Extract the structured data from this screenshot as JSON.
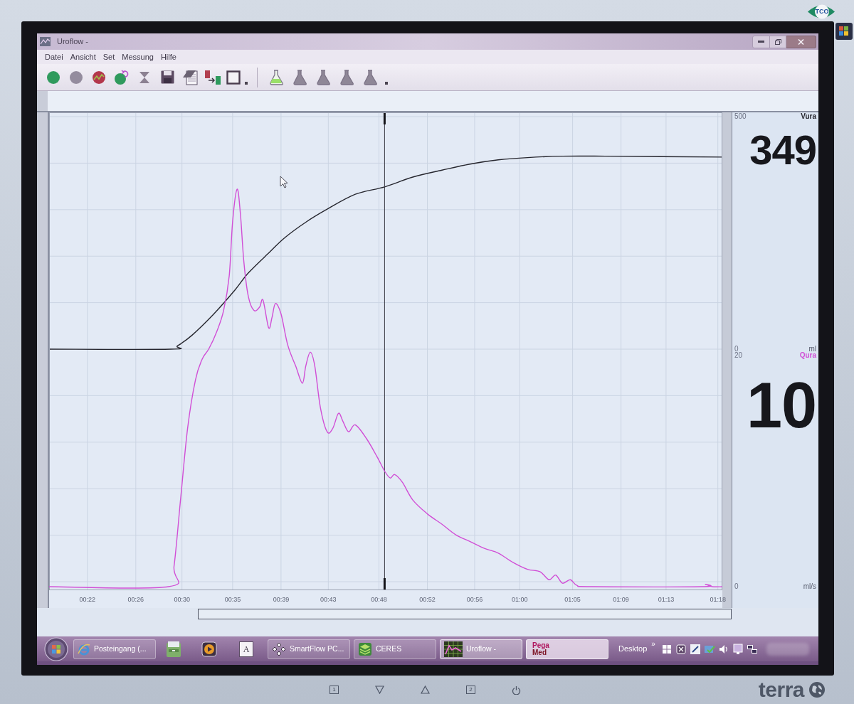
{
  "window": {
    "title": "Uroflow -"
  },
  "menu": [
    "Datei",
    "Ansicht",
    "Set",
    "Messung",
    "Hilfe"
  ],
  "toolbar": {
    "flasks": [
      {
        "selected": true
      },
      {
        "selected": false
      },
      {
        "selected": false
      },
      {
        "selected": false
      },
      {
        "selected": false
      }
    ]
  },
  "plot": {
    "volume_chart": {
      "chart_data": {
        "type": "line",
        "ylabel": "ml",
        "xlim": [
          18.6,
          78.4
        ],
        "ylim": [
          -518.3,
          509.2
        ],
        "grid": true,
        "x": [
          18.6,
          29.4,
          30.0,
          31.3,
          33.2,
          35.1,
          36.3,
          38.2,
          39.5,
          41.4,
          43.3,
          45.8,
          48.4,
          50.9,
          53.5,
          56.0,
          58.5,
          61.1,
          64.2,
          68.0,
          78.4
        ],
        "series": [
          {
            "name": "Vura",
            "color": "#26262e",
            "values": [
              0,
              0,
              7,
              30,
              75,
              127,
              164,
              209,
              239,
              273,
              301,
              333,
              349,
              370,
              385,
              398,
              407,
              412,
              415,
              415,
              413
            ]
          }
        ],
        "xticks": [
          {
            "value": 22,
            "label": "00:22"
          },
          {
            "value": 26.3,
            "label": "00:26"
          },
          {
            "value": 30.4,
            "label": "00:30"
          },
          {
            "value": 34.9,
            "label": "00:35"
          },
          {
            "value": 39.2,
            "label": "00:39"
          },
          {
            "value": 43.4,
            "label": "00:43"
          },
          {
            "value": 47.9,
            "label": "00:48"
          },
          {
            "value": 52.2,
            "label": "00:52"
          },
          {
            "value": 56.4,
            "label": "00:56"
          },
          {
            "value": 60.4,
            "label": "01:00"
          },
          {
            "value": 65.1,
            "label": "01:05"
          },
          {
            "value": 69.4,
            "label": "01:09"
          },
          {
            "value": 73.4,
            "label": "01:13"
          },
          {
            "value": 78.0,
            "label": "01:18"
          }
        ],
        "yticks": [
          0,
          500
        ],
        "ref_lines": [
          {
            "axis": "x",
            "value": 48.4
          }
        ]
      }
    },
    "flow_chart": {
      "chart_data": {
        "type": "line",
        "ylabel": "ml/s",
        "xlim": [
          18.6,
          78.4
        ],
        "ylim": [
          -0.31,
          41.05
        ],
        "x": [
          18.6,
          29.2,
          29.7,
          30.3,
          30.9,
          31.6,
          32.2,
          32.8,
          33.5,
          34.1,
          34.6,
          34.9,
          35.3,
          35.6,
          35.9,
          36.3,
          36.8,
          37.3,
          37.6,
          38.1,
          38.4,
          38.7,
          39.2,
          39.8,
          40.5,
          41.1,
          41.4,
          41.8,
          42.2,
          42.7,
          43.3,
          43.8,
          44.3,
          44.7,
          45.2,
          45.8,
          46.8,
          47.7,
          48.4,
          48.9,
          49.3,
          50.0,
          50.9,
          52.2,
          53.5,
          54.7,
          56.0,
          57.3,
          58.5,
          59.8,
          61.1,
          62.2,
          63.0,
          63.6,
          64.2,
          64.9,
          65.5,
          66.8,
          76.6,
          76.9,
          77.5,
          78.4
        ],
        "series": [
          {
            "name": "Qura",
            "color": "#d14fd6",
            "values": [
              0,
              0,
              1.8,
              7.8,
              13.7,
              17.9,
              19.7,
              20.6,
              22.1,
              23.9,
              26.9,
              31.6,
              34.4,
              32.2,
              28.1,
              25.1,
              23.9,
              24.2,
              24.8,
              22.4,
              23.3,
              24.5,
              23.6,
              20.9,
              19.1,
              17.6,
              19.1,
              20.3,
              19.1,
              15.5,
              13.4,
              13.7,
              15.0,
              14.3,
              13.4,
              14.0,
              12.8,
              11.3,
              10.0,
              9.4,
              9.7,
              9.0,
              7.5,
              6.3,
              5.4,
              4.5,
              3.9,
              3.3,
              2.9,
              2.1,
              1.5,
              1.3,
              0.6,
              1.0,
              0.3,
              0.6,
              0.1,
              0,
              0,
              0.2,
              0,
              0
            ]
          }
        ],
        "yticks": [
          0,
          20
        ]
      }
    }
  },
  "readouts": [
    {
      "value": "349"
    },
    {
      "value": "10"
    }
  ],
  "taskbar": {
    "items": [
      {
        "kind": "start"
      },
      {
        "kind": "window",
        "label": "Posteingang (...",
        "selected": false
      },
      {
        "kind": "pinned"
      },
      {
        "kind": "pinned"
      },
      {
        "kind": "letter_tile",
        "label": "A"
      },
      {
        "kind": "window",
        "label": "SmartFlow PC...",
        "selected": false
      },
      {
        "kind": "window",
        "label": "CERES",
        "selected": false
      },
      {
        "kind": "window",
        "label": "Uroflow -",
        "selected": true
      },
      {
        "kind": "logo_window",
        "logo": [
          "Pega",
          "Med"
        ],
        "selected": false
      }
    ],
    "toolbar_label": "Desktop",
    "chevron": "»"
  },
  "monitor": {
    "badge": "TCO",
    "buttons": [
      {
        "kind": "numbered",
        "label": "1"
      },
      {
        "kind": "down"
      },
      {
        "kind": "up"
      },
      {
        "kind": "numbered",
        "label": "2"
      },
      {
        "kind": "power"
      }
    ],
    "brand": "terra"
  }
}
